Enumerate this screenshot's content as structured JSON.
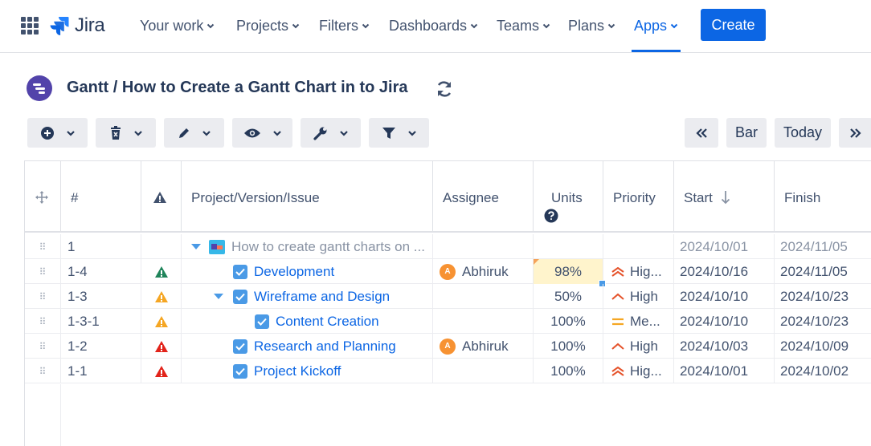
{
  "nav": {
    "logo_text": "Jira",
    "items": [
      {
        "label": "Your work"
      },
      {
        "label": "Projects"
      },
      {
        "label": "Filters"
      },
      {
        "label": "Dashboards"
      },
      {
        "label": "Teams"
      },
      {
        "label": "Plans"
      },
      {
        "label": "Apps"
      }
    ],
    "active_item": "Apps",
    "create_label": "Create"
  },
  "page": {
    "title": "Gantt / How to Create a Gantt Chart in to Jira"
  },
  "toolbar": {
    "bar_label": "Bar",
    "today_label": "Today"
  },
  "grid": {
    "headers": {
      "hash": "#",
      "issue": "Project/Version/Issue",
      "assignee": "Assignee",
      "units": "Units",
      "priority": "Priority",
      "start": "Start",
      "finish": "Finish"
    },
    "rows": [
      {
        "id": "1",
        "warning": "",
        "issue": "How to create gantt charts on ...",
        "assignee": "",
        "units": "",
        "priority": "",
        "start": "2024/10/01",
        "finish": "2024/11/05"
      },
      {
        "id": "1-4",
        "warning": "green",
        "issue": "Development",
        "assignee": "Abhiruk",
        "units": "98%",
        "priority": "Hig...",
        "start": "2024/10/16",
        "finish": "2024/11/05"
      },
      {
        "id": "1-3",
        "warning": "orange",
        "issue": "Wireframe and Design",
        "assignee": "",
        "units": "50%",
        "priority": "High",
        "start": "2024/10/10",
        "finish": "2024/10/23"
      },
      {
        "id": "1-3-1",
        "warning": "orange",
        "issue": "Content Creation",
        "assignee": "",
        "units": "100%",
        "priority": "Me...",
        "start": "2024/10/10",
        "finish": "2024/10/23"
      },
      {
        "id": "1-2",
        "warning": "red",
        "issue": "Research and Planning",
        "assignee": "Abhiruk",
        "units": "100%",
        "priority": "High",
        "start": "2024/10/03",
        "finish": "2024/10/09"
      },
      {
        "id": "1-1",
        "warning": "red",
        "issue": "Project Kickoff",
        "assignee": "",
        "units": "100%",
        "priority": "Hig...",
        "start": "2024/10/01",
        "finish": "2024/10/02"
      }
    ]
  },
  "colors": {
    "accent": "#0C66E4",
    "warning_green": "#1F845A",
    "warning_orange": "#F5A623",
    "warning_red": "#E2231A",
    "priority_high": "#E5532B",
    "priority_medium": "#F5A623"
  }
}
